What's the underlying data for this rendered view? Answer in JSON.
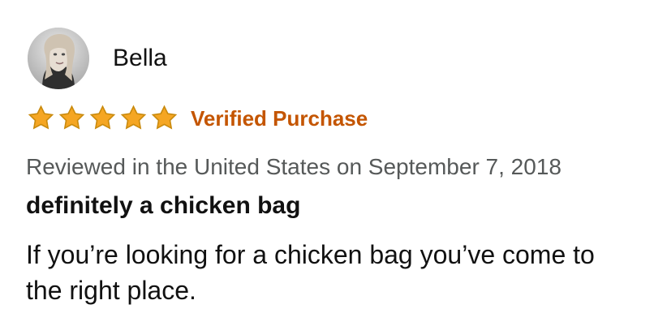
{
  "review": {
    "reviewer_name": "Bella",
    "rating": {
      "value": 5,
      "max": 5,
      "star_color": "#f5a623",
      "star_outline_color": "#c98a0d"
    },
    "verified_label": "Verified Purchase",
    "verified_color": "#c45500",
    "date_text": "Reviewed in the United States on September 7, 2018",
    "title": "definitely a chicken bag",
    "body": "If you’re looking for a chicken bag you’ve come to the right place."
  }
}
